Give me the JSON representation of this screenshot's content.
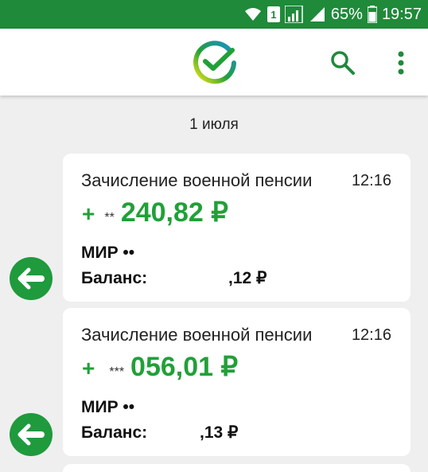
{
  "status_bar": {
    "sim": "1",
    "battery": "65%",
    "time": "19:57"
  },
  "app_bar": {
    "logo_icon": "sber-logo-icon",
    "search_icon": "search-icon",
    "more_icon": "more-vert-icon",
    "accent_color": "#21a038"
  },
  "date_label": "1 июля",
  "transactions": [
    {
      "title": "Зачисление военной пенсии",
      "time": "12:16",
      "sign": "+",
      "masked": "**",
      "amount": "240,82 ₽",
      "card": "МИР ••",
      "balance_label": "Баланс:",
      "balance_value": ",12 ₽"
    },
    {
      "title": "Зачисление военной пенсии",
      "time": "12:16",
      "sign": "+",
      "masked": "***",
      "amount": "056,01 ₽",
      "card": "МИР ••",
      "balance_label": "Баланс:",
      "balance_value": ",13 ₽"
    }
  ]
}
